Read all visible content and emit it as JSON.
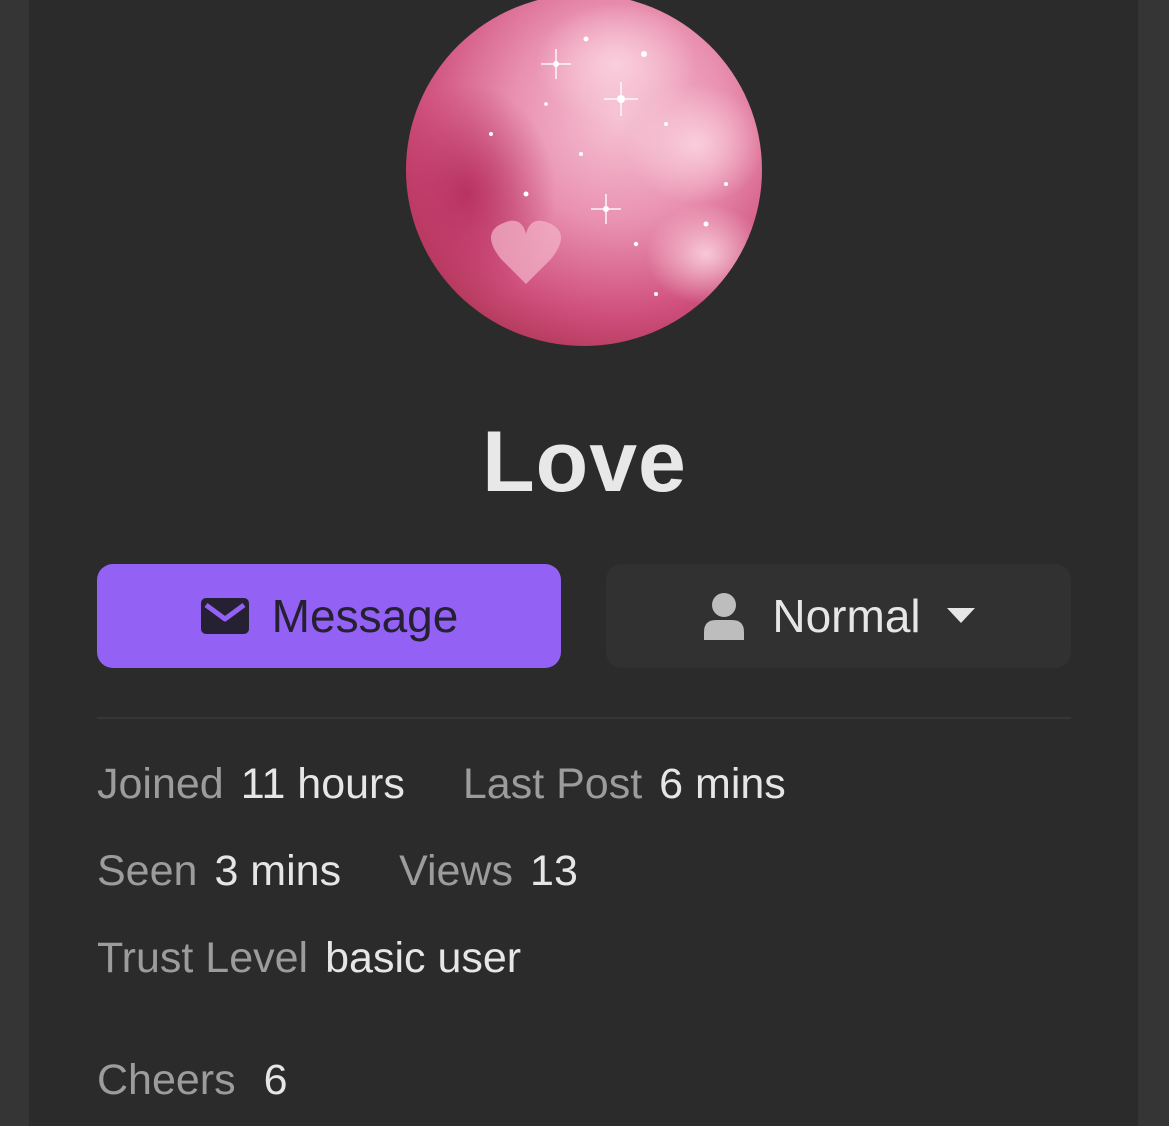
{
  "profile": {
    "username": "Love",
    "avatar_description": "pink-glitter-hearts"
  },
  "actions": {
    "message_label": "Message",
    "notification_level_label": "Normal"
  },
  "stats": {
    "joined_label": "Joined",
    "joined_value": "11 hours",
    "last_post_label": "Last Post",
    "last_post_value": "6 mins",
    "seen_label": "Seen",
    "seen_value": "3 mins",
    "views_label": "Views",
    "views_value": "13",
    "trust_level_label": "Trust Level",
    "trust_level_value": "basic user",
    "cheers_label": "Cheers",
    "cheers_value": "6"
  },
  "colors": {
    "background": "#2b2b2b",
    "accent": "#9461f5",
    "text_primary": "#e6e6e6",
    "text_secondary": "#9c9c9c"
  }
}
